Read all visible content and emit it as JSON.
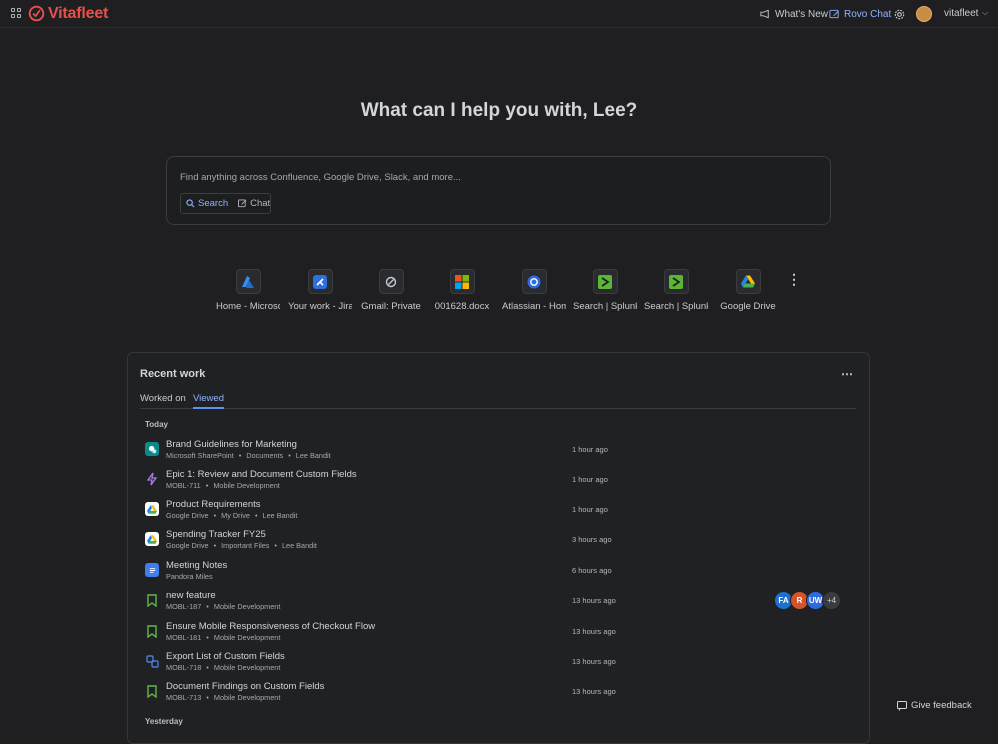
{
  "brand": {
    "name": "Vitafleet",
    "color": "#e8504c"
  },
  "topbar": {
    "whats_new": "What's New",
    "rovo_chat": "Rovo Chat",
    "user": "vitafleet"
  },
  "home": {
    "headline": "What can I help you with, Lee?",
    "search_placeholder": "Find anything across Confluence, Google Drive, Slack, and more...",
    "mode_search": "Search",
    "mode_chat": "Chat"
  },
  "apps": [
    {
      "label": "Home - Microsoft",
      "icon": "azure-icon"
    },
    {
      "label": "Your work - Jira",
      "icon": "jira-icon"
    },
    {
      "label": "Gmail: Private",
      "icon": "gmail-icon"
    },
    {
      "label": "001628.docx",
      "icon": "microsoft-icon"
    },
    {
      "label": "Atlassian - Home",
      "icon": "atlassian-icon"
    },
    {
      "label": "Search | Splunk",
      "icon": "splunk-icon"
    },
    {
      "label": "Search | Splunk",
      "icon": "splunk-icon"
    },
    {
      "label": "Google Drive",
      "icon": "google-drive-icon"
    }
  ],
  "recent": {
    "title": "Recent work",
    "tabs": [
      "Worked on",
      "Viewed"
    ],
    "active_tab": "Viewed",
    "groups": {
      "today": "Today",
      "yesterday": "Yesterday"
    },
    "rows": [
      {
        "title": "Brand Guidelines for Marketing",
        "meta": [
          "Microsoft SharePoint",
          "Documents",
          "Lee Bandit"
        ],
        "time": "1 hour ago",
        "icon": "sharepoint-icon"
      },
      {
        "title": "Epic 1: Review and Document Custom Fields",
        "meta": [
          "MOBL-711",
          "Mobile Development"
        ],
        "time": "1 hour ago",
        "icon": "epic-icon"
      },
      {
        "title": "Product Requirements",
        "meta": [
          "Google Drive",
          "My Drive",
          "Lee Bandit"
        ],
        "time": "1 hour ago",
        "icon": "google-drive-icon"
      },
      {
        "title": "Spending Tracker FY25",
        "meta": [
          "Google Drive",
          "Important Files",
          "Lee Bandit"
        ],
        "time": "3 hours ago",
        "icon": "google-drive-icon"
      },
      {
        "title": "Meeting Notes",
        "meta": [
          "Pandora Miles"
        ],
        "time": "6 hours ago",
        "icon": "google-docs-icon"
      },
      {
        "title": "new feature",
        "meta": [
          "MOBL-187",
          "Mobile Development"
        ],
        "time": "13 hours ago",
        "icon": "story-icon"
      },
      {
        "title": "Ensure Mobile Responsiveness of Checkout Flow",
        "meta": [
          "MOBL-181",
          "Mobile Development"
        ],
        "time": "13 hours ago",
        "icon": "story-icon"
      },
      {
        "title": "Export List of Custom Fields",
        "meta": [
          "MOBL-718",
          "Mobile Development"
        ],
        "time": "13 hours ago",
        "icon": "subtask-icon"
      },
      {
        "title": "Document Findings on Custom Fields",
        "meta": [
          "MOBL-713",
          "Mobile Development"
        ],
        "time": "13 hours ago",
        "icon": "story-icon"
      }
    ],
    "collaborators": [
      {
        "initials": "FA",
        "color": "#1f6fd1"
      },
      {
        "initials": "R",
        "color": "#d4532a"
      },
      {
        "initials": "UW",
        "color": "#2f6be0"
      },
      {
        "initials": "+4",
        "color": "#3a3c40"
      }
    ]
  },
  "feedback": "Give feedback"
}
